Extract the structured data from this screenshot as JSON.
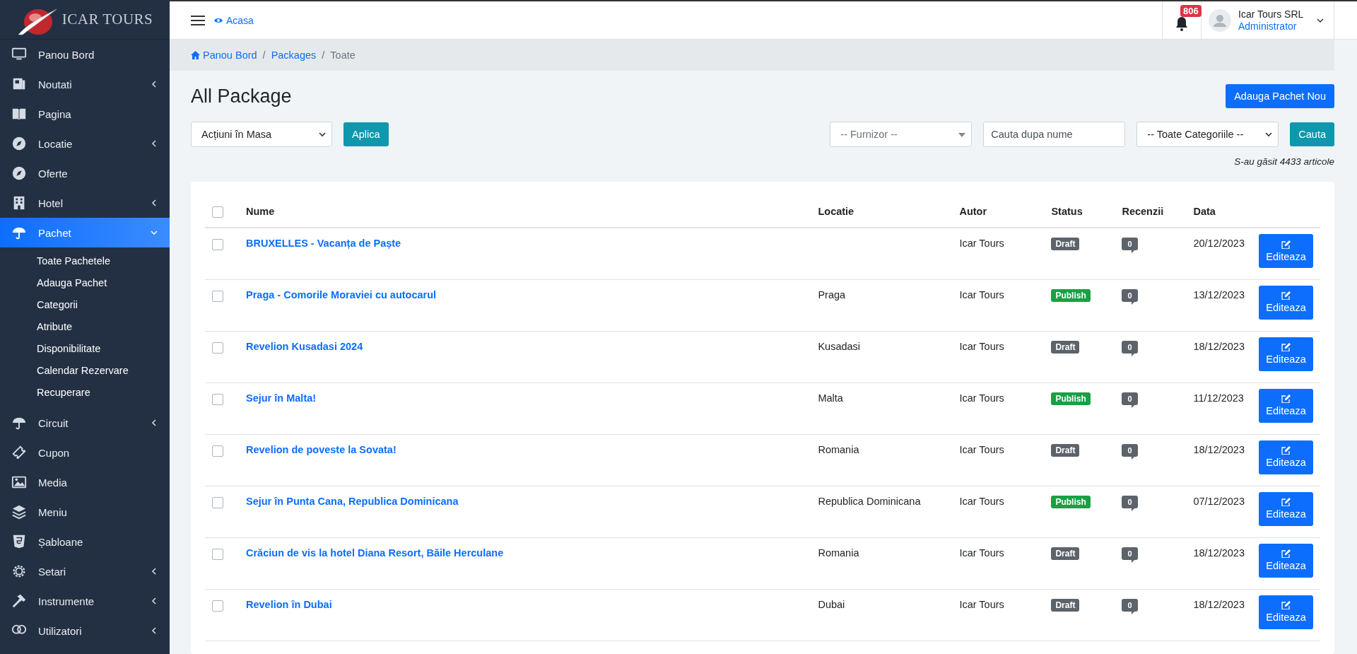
{
  "brand": {
    "logo_text": "ICAR TOURS"
  },
  "sidebar": {
    "items": [
      {
        "label": "Panou Bord",
        "expandable": false,
        "selected": false
      },
      {
        "label": "Noutati",
        "expandable": true,
        "expanded": false,
        "selected": false
      },
      {
        "label": "Pagina",
        "expandable": false,
        "selected": false
      },
      {
        "label": "Locatie",
        "expandable": true,
        "expanded": false,
        "selected": false
      },
      {
        "label": "Oferte",
        "expandable": false,
        "selected": false
      },
      {
        "label": "Hotel",
        "expandable": true,
        "expanded": false,
        "selected": false
      },
      {
        "label": "Pachet",
        "expandable": true,
        "expanded": true,
        "selected": true,
        "children": [
          {
            "label": "Toate Pachetele"
          },
          {
            "label": "Adauga Pachet"
          },
          {
            "label": "Categorii"
          },
          {
            "label": "Atribute"
          },
          {
            "label": "Disponibilitate"
          },
          {
            "label": "Calendar Rezervare"
          },
          {
            "label": "Recuperare"
          }
        ]
      },
      {
        "label": "Circuit",
        "expandable": true,
        "expanded": false,
        "selected": false
      },
      {
        "label": "Cupon",
        "expandable": false,
        "selected": false
      },
      {
        "label": "Media",
        "expandable": false,
        "selected": false
      },
      {
        "label": "Meniu",
        "expandable": false,
        "selected": false
      },
      {
        "label": "Șabloane",
        "expandable": false,
        "selected": false
      },
      {
        "label": "Setari",
        "expandable": true,
        "expanded": false,
        "selected": false
      },
      {
        "label": "Instrumente",
        "expandable": true,
        "expanded": false,
        "selected": false
      },
      {
        "label": "Utilizatori",
        "expandable": true,
        "expanded": false,
        "selected": false
      }
    ]
  },
  "topbar": {
    "home_link": "Acasa",
    "notification_count": "806",
    "user_name": "Icar Tours SRL",
    "user_role": "Administrator"
  },
  "breadcrumb": [
    {
      "label": "Panou Bord"
    },
    {
      "separator": "/",
      "label": "Packages"
    },
    {
      "separator": "/",
      "label": "Toate"
    }
  ],
  "page_title": "All Package",
  "add_button": "Adauga Pachet Nou",
  "bulk_action": {
    "value": "Acțiuni în Masa"
  },
  "apply_button": "Aplica",
  "supplier_filter": {
    "placeholder": "-- Furnizor --"
  },
  "name_search": {
    "placeholder": "Cauta dupa nume"
  },
  "category_filter": {
    "value": "-- Toate Categoriile --"
  },
  "search_button": "Cauta",
  "result_count": "S-au găsit 4433 articole",
  "table": {
    "select_all": {
      "checked": false
    },
    "columns": [
      "Nume",
      "Locatie",
      "Autor",
      "Status",
      "Recenzii",
      "Data"
    ],
    "rows": [
      {
        "checked": false,
        "name": "BRUXELLES - Vacanța de Paște",
        "location": "",
        "author": "Icar Tours",
        "status": {
          "label": "Draft",
          "kind": "draft"
        },
        "reviews": "0",
        "date": "20/12/2023",
        "action": "Editeaza"
      },
      {
        "checked": false,
        "name": "Praga - Comorile Moraviei cu autocarul",
        "location": "Praga",
        "author": "Icar Tours",
        "status": {
          "label": "Publish",
          "kind": "publish"
        },
        "reviews": "0",
        "date": "13/12/2023",
        "action": "Editeaza"
      },
      {
        "checked": false,
        "name": "Revelion Kusadasi 2024",
        "location": "Kusadasi",
        "author": "Icar Tours",
        "status": {
          "label": "Draft",
          "kind": "draft"
        },
        "reviews": "0",
        "date": "18/12/2023",
        "action": "Editeaza"
      },
      {
        "checked": false,
        "name": "Sejur în Malta!",
        "location": "Malta",
        "author": "Icar Tours",
        "status": {
          "label": "Publish",
          "kind": "publish"
        },
        "reviews": "0",
        "date": "11/12/2023",
        "action": "Editeaza"
      },
      {
        "checked": false,
        "name": "Revelion de poveste la Sovata!",
        "location": "Romania",
        "author": "Icar Tours",
        "status": {
          "label": "Draft",
          "kind": "draft"
        },
        "reviews": "0",
        "date": "18/12/2023",
        "action": "Editeaza"
      },
      {
        "checked": false,
        "name": "Sejur în Punta Cana, Republica Dominicana",
        "location": "Republica Dominicana",
        "author": "Icar Tours",
        "status": {
          "label": "Publish",
          "kind": "publish"
        },
        "reviews": "0",
        "date": "07/12/2023",
        "action": "Editeaza"
      },
      {
        "checked": false,
        "name": "Crăciun de vis la hotel Diana Resort, Băile Herculane",
        "location": "Romania",
        "author": "Icar Tours",
        "status": {
          "label": "Draft",
          "kind": "draft"
        },
        "reviews": "0",
        "date": "18/12/2023",
        "action": "Editeaza"
      },
      {
        "checked": false,
        "name": "Revelion în Dubai",
        "location": "Dubai",
        "author": "Icar Tours",
        "status": {
          "label": "Draft",
          "kind": "draft"
        },
        "reviews": "0",
        "date": "18/12/2023",
        "action": "Editeaza"
      }
    ]
  }
}
